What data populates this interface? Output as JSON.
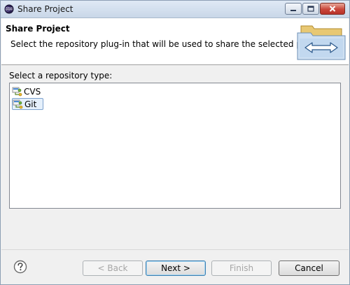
{
  "window": {
    "title": "Share Project"
  },
  "banner": {
    "title": "Share Project",
    "description": "Select the repository plug-in that will be used to share the selected project."
  },
  "repository": {
    "label": "Select a repository type:",
    "items": [
      {
        "label": "CVS",
        "selected": false,
        "icon": "repository-icon"
      },
      {
        "label": "Git",
        "selected": true,
        "icon": "repository-icon"
      }
    ]
  },
  "buttons": {
    "help_icon": "question-circle-icon",
    "back": "< Back",
    "next": "Next >",
    "finish": "Finish",
    "cancel": "Cancel"
  },
  "colors": {
    "selection_bg": "#e5f0fb",
    "selection_border": "#7da2ce",
    "default_button_border": "#3c7fb1"
  }
}
